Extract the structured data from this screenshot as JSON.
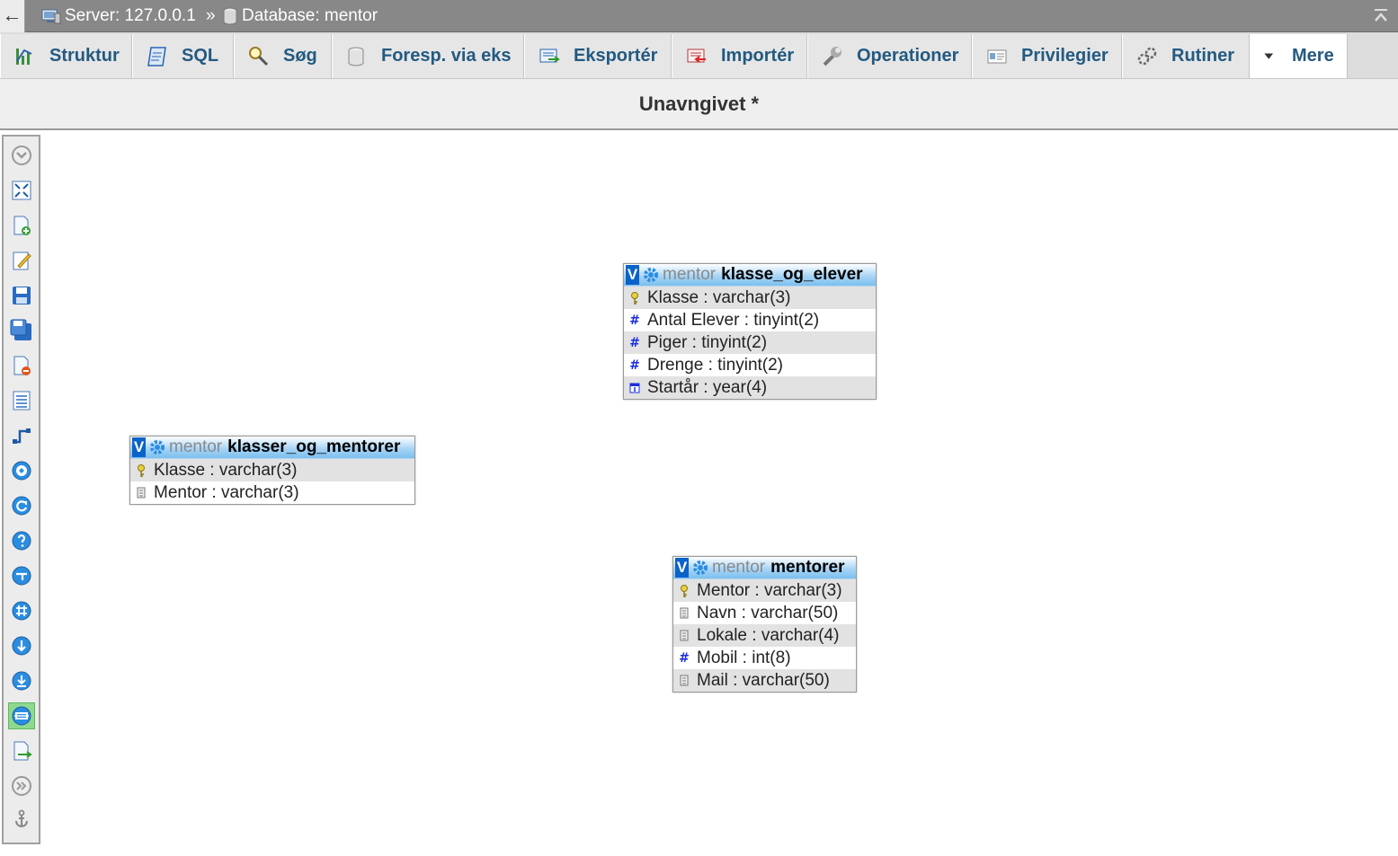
{
  "topbar": {
    "back": "←",
    "server": "Server: 127.0.0.1",
    "separator": "»",
    "database": "Database: mentor"
  },
  "tabs": [
    {
      "label": "Struktur",
      "icon": "structure-icon"
    },
    {
      "label": "SQL",
      "icon": "sql-icon"
    },
    {
      "label": "Søg",
      "icon": "search-icon"
    },
    {
      "label": "Foresp. via eks",
      "icon": "query-icon"
    },
    {
      "label": "Eksportér",
      "icon": "export-icon"
    },
    {
      "label": "Importér",
      "icon": "import-icon"
    },
    {
      "label": "Operationer",
      "icon": "wrench-icon"
    },
    {
      "label": "Privilegier",
      "icon": "privileges-icon"
    },
    {
      "label": "Rutiner",
      "icon": "routines-icon"
    },
    {
      "label": "Mere",
      "icon": "chevron-down-icon"
    }
  ],
  "designer_title": "Unavngivet *",
  "sidebar_tools": [
    "show-menu-icon",
    "fullscreen-icon",
    "new-page-icon",
    "edit-page-icon",
    "save-icon",
    "save-as-icon",
    "delete-page-icon",
    "table-list-icon",
    "create-relation-icon",
    "choose-display-field-icon",
    "reload-icon",
    "help-icon",
    "angular-links-icon",
    "snap-to-grid-icon",
    "small-big-all-icon",
    "toggle-small-big-icon",
    "toggle-relation-lines-icon",
    "export-schema-icon",
    "hide-menu-icon",
    "pin-text-icon"
  ],
  "tables": [
    {
      "db": "mentor",
      "name": "klasse_og_elever",
      "toggle": "V",
      "columns": [
        {
          "text": "Klasse : varchar(3)",
          "type": "key"
        },
        {
          "text": "Antal Elever : tinyint(2)",
          "type": "number"
        },
        {
          "text": "Piger : tinyint(2)",
          "type": "number"
        },
        {
          "text": "Drenge : tinyint(2)",
          "type": "number"
        },
        {
          "text": "Startår : year(4)",
          "type": "date"
        }
      ]
    },
    {
      "db": "mentor",
      "name": "klasser_og_mentorer",
      "toggle": "V",
      "columns": [
        {
          "text": "Klasse : varchar(3)",
          "type": "key"
        },
        {
          "text": "Mentor : varchar(3)",
          "type": "text"
        }
      ]
    },
    {
      "db": "mentor",
      "name": "mentorer",
      "toggle": "V",
      "columns": [
        {
          "text": "Mentor : varchar(3)",
          "type": "key"
        },
        {
          "text": "Navn : varchar(50)",
          "type": "text"
        },
        {
          "text": "Lokale : varchar(4)",
          "type": "text"
        },
        {
          "text": "Mobil : int(8)",
          "type": "number"
        },
        {
          "text": "Mail : varchar(50)",
          "type": "text"
        }
      ]
    }
  ]
}
